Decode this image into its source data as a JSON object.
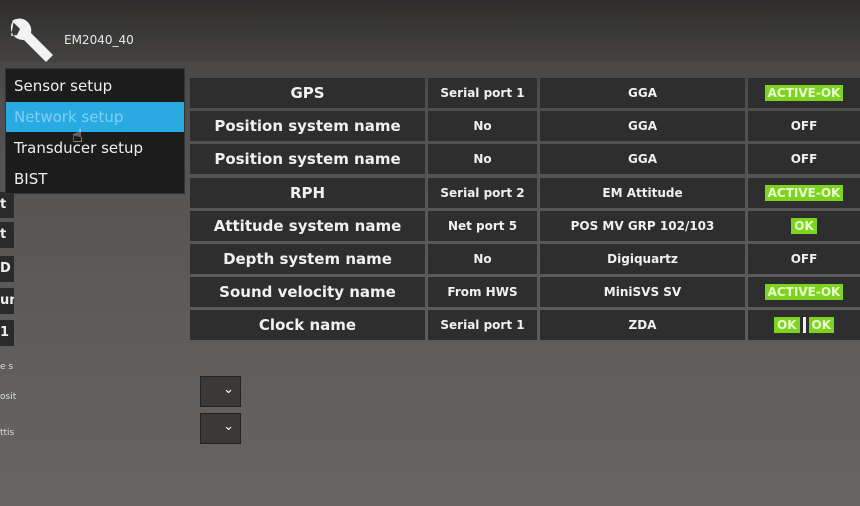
{
  "header": {
    "title": "EM2040_40",
    "icon": "wrench-icon"
  },
  "menu": {
    "items": [
      {
        "label": "Sensor setup",
        "selected": false
      },
      {
        "label": "Network setup",
        "selected": true
      },
      {
        "label": "Transducer setup",
        "selected": false
      },
      {
        "label": "BIST",
        "selected": false
      }
    ]
  },
  "left_fragments": [
    "t",
    "t",
    "D",
    "un",
    "1"
  ],
  "left_small": [
    "e s",
    "osit",
    "ttis"
  ],
  "table": {
    "rows": [
      {
        "name": "GPS",
        "port": "Serial port 1",
        "data": "GGA",
        "status": [
          "ACTIVE-OK"
        ]
      },
      {
        "name": "Position system name",
        "port": "No",
        "data": "GGA",
        "status": [
          "OFF"
        ]
      },
      {
        "name": "Position system name",
        "port": "No",
        "data": "GGA",
        "status": [
          "OFF"
        ]
      },
      {
        "name": "RPH",
        "port": "Serial port 2",
        "data": "EM Attitude",
        "status": [
          "ACTIVE-OK"
        ]
      },
      {
        "name": "Attitude system name",
        "port": "Net port 5",
        "data": "POS MV GRP 102/103",
        "status": [
          "OK"
        ]
      },
      {
        "name": "Depth system name",
        "port": "No",
        "data": "Digiquartz",
        "status": [
          "OFF"
        ]
      },
      {
        "name": "Sound velocity name",
        "port": "From HWS",
        "data": "MiniSVS SV",
        "status": [
          "ACTIVE-OK"
        ]
      },
      {
        "name": "Clock name",
        "port": "Serial port 1",
        "data": "ZDA",
        "status": [
          "OK",
          "OK"
        ]
      }
    ]
  },
  "colors": {
    "ok_badge": "#7ed321",
    "menu_selected": "#2aaae2",
    "cell_bg": "#2e2e2e"
  }
}
